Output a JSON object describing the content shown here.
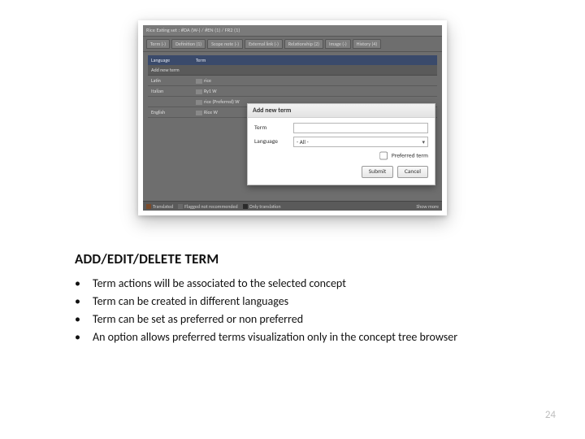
{
  "screenshot": {
    "header": "Rice Eating set : #DA (W-) / #EN (1) / FR2 (1)",
    "tabs": [
      "Term (-)",
      "Definition (1)",
      "Scope note (-)",
      "External link (-)",
      "Relationship (2)",
      "Image (-)",
      "History (4)"
    ],
    "table_headers": {
      "lang": "Language",
      "term": "Term"
    },
    "add_row_label": "Add new term",
    "rows": [
      {
        "lang": "Latin",
        "term": "rice"
      },
      {
        "lang": "Italian",
        "term": "Ry1 W"
      },
      {
        "lang": "",
        "term": "rice (Preferred) W"
      },
      {
        "lang": "English",
        "term": "Rice W"
      }
    ],
    "footer": {
      "legend1": "Translated",
      "legend2": "Flagged not recommended",
      "legend3": "Only translation",
      "right": "Show more"
    }
  },
  "dialog": {
    "title": "Add new term",
    "field_term_label": "Term",
    "field_term_value": "",
    "field_lang_label": "Language",
    "field_lang_value": "- All -",
    "checkbox_label": "Preferred term",
    "submit_label": "Submit",
    "cancel_label": "Cancel"
  },
  "heading": "ADD/EDIT/DELETE TERM",
  "bullets": [
    "Term actions will be associated to the selected concept",
    "Term can be created in different languages",
    "Term can be set as preferred or non preferred",
    "An option allows preferred terms visualization only in the concept tree browser"
  ],
  "page_number": "24"
}
